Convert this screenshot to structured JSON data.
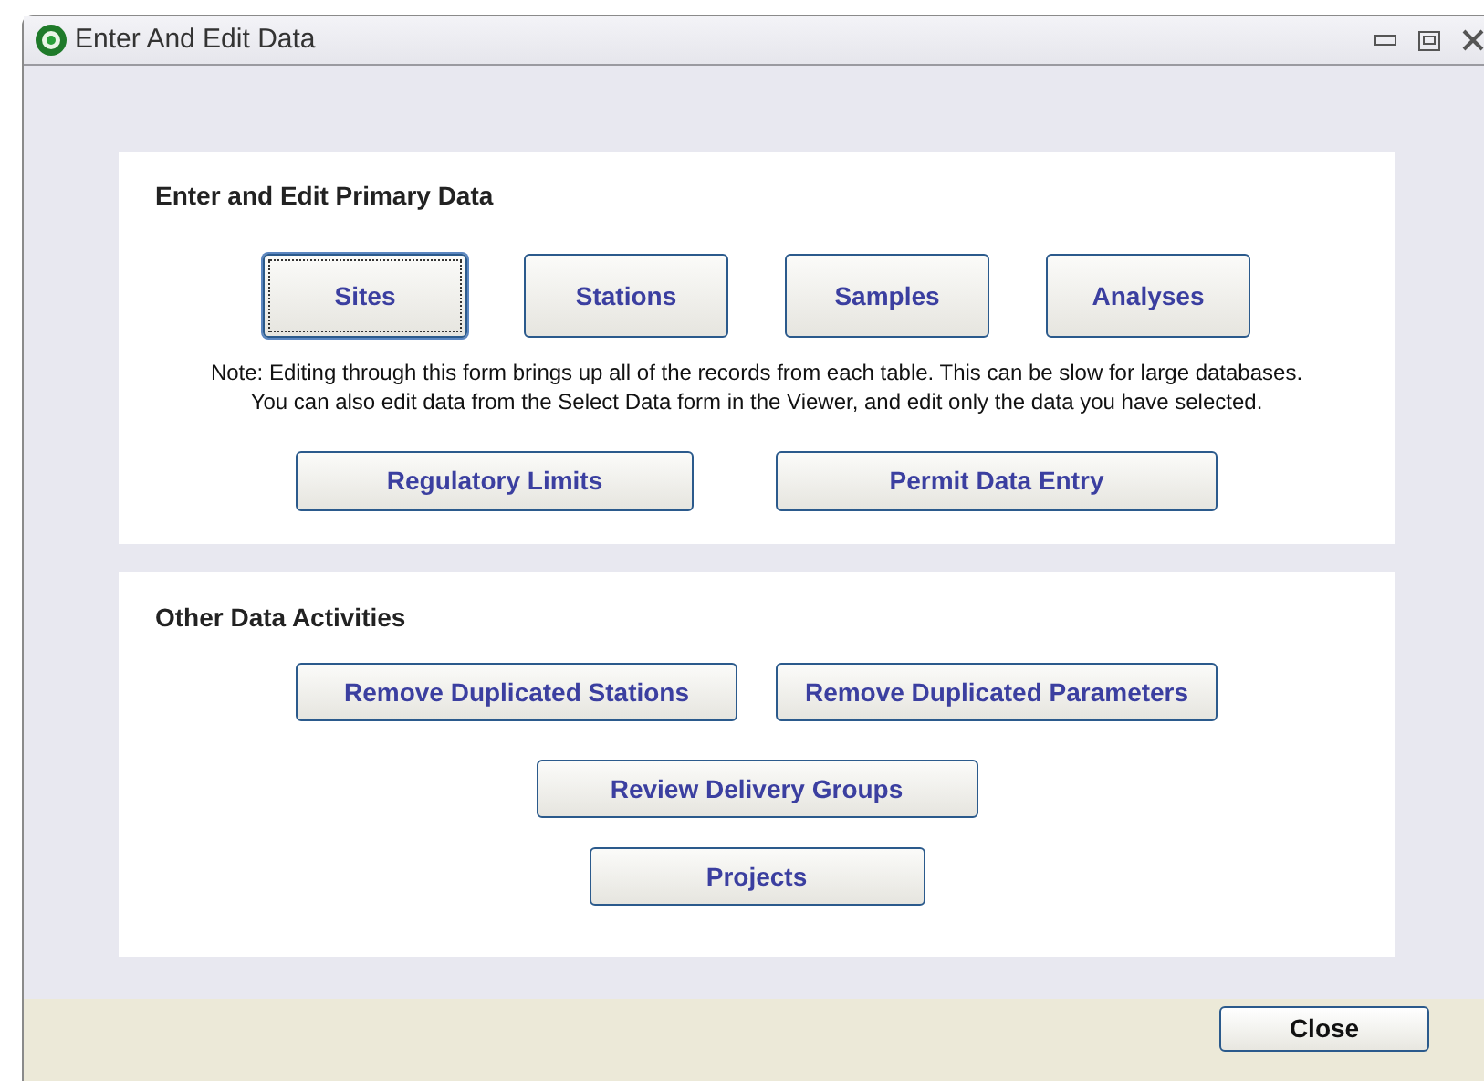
{
  "window": {
    "title": "Enter And Edit Data"
  },
  "primary": {
    "heading": "Enter and Edit Primary Data",
    "buttons": [
      {
        "label": "Sites",
        "selected": true
      },
      {
        "label": "Stations",
        "selected": false
      },
      {
        "label": "Samples",
        "selected": false
      },
      {
        "label": "Analyses",
        "selected": false
      }
    ],
    "note": [
      "Note: Editing through this form brings up all of the records from each table. This can be slow for large databases.",
      "You can also edit data from the Select Data form in the Viewer, and edit only the data you have selected."
    ],
    "more_buttons": [
      "Regulatory Limits",
      "Permit Data Entry"
    ]
  },
  "other": {
    "heading": "Other Data Activities",
    "row_buttons": [
      "Remove Duplicated Stations",
      "Remove Duplicated Parameters"
    ],
    "buttons": [
      "Review Delivery Groups",
      "Projects"
    ]
  },
  "footer": {
    "close": "Close"
  }
}
